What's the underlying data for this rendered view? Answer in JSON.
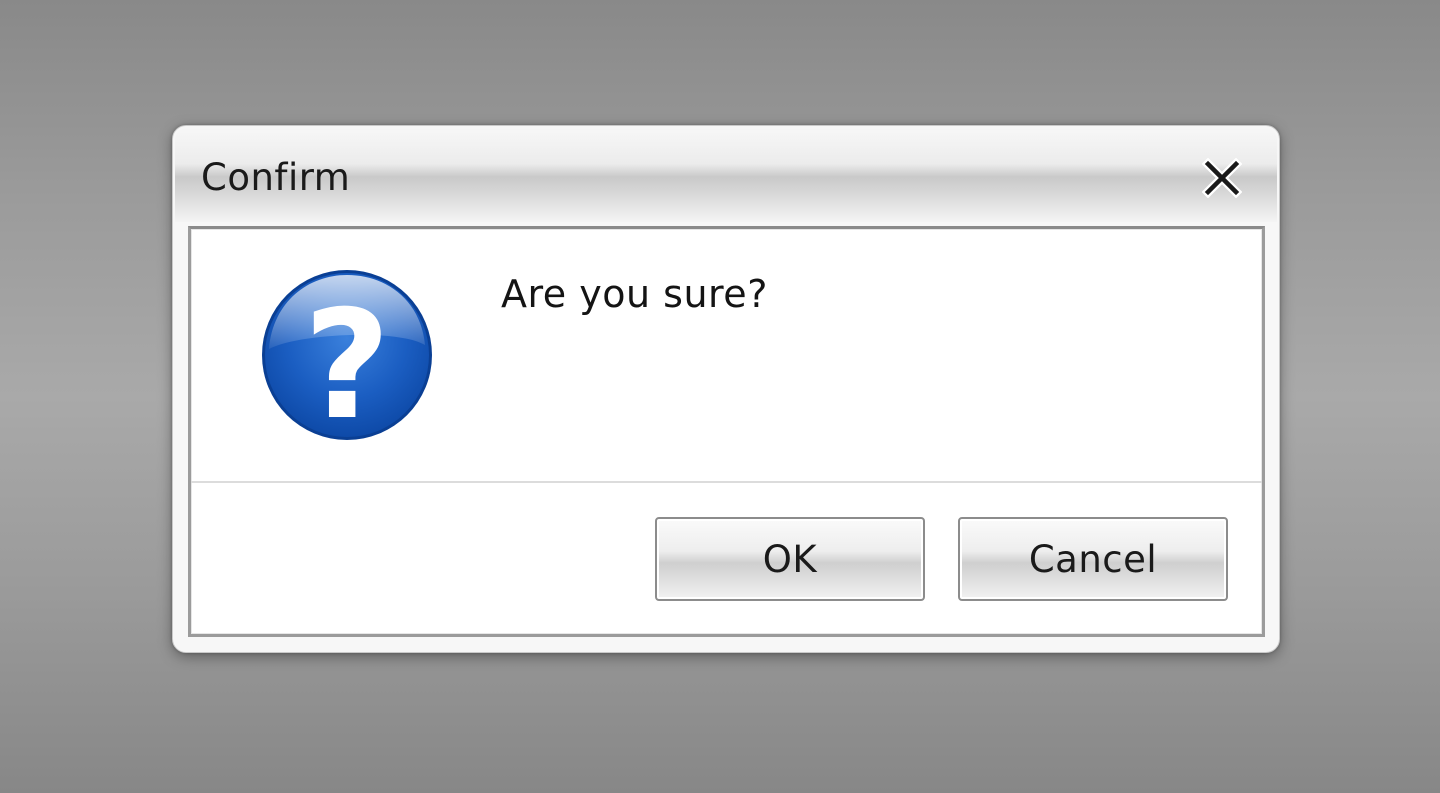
{
  "dialog": {
    "title": "Confirm",
    "close_label": "X",
    "message": "Are you sure?",
    "icon": "question-icon",
    "buttons": {
      "ok_label": "OK",
      "cancel_label": "Cancel"
    }
  },
  "colors": {
    "icon_blue": "#1f63c4",
    "icon_blue_dark": "#0d4fb5",
    "background": "#9b9b9b"
  }
}
